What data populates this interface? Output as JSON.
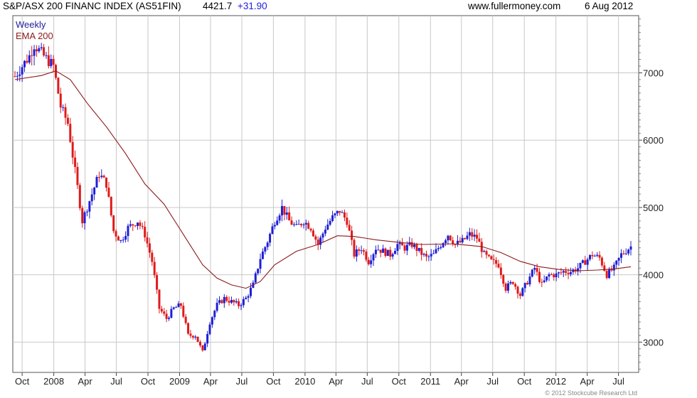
{
  "header": {
    "title": "S&P/ASX 200 FINANC INDEX (AS51FIN)",
    "last_value": "4421.7",
    "change": "+31.90",
    "site": "www.fullermoney.com",
    "date": "6 Aug 2012"
  },
  "copyright": "© 2012 Stockcube Research Ltd",
  "colors": {
    "up": "#1f1fd6",
    "down": "#e01a1a",
    "ema": "#8b1a1a",
    "grid": "#c8c8c8",
    "title_label": "#1f1f9c"
  },
  "chart_data": {
    "type": "candlestick",
    "title": "S&P/ASX 200 FINANC INDEX (AS51FIN)",
    "interval": "Weekly",
    "legend": [
      "Weekly",
      "EMA 200"
    ],
    "legend_position": "top-left",
    "x_range": [
      "2007-09-10",
      "2012-08-06"
    ],
    "ylim": [
      2550,
      7850
    ],
    "y_ticks": [
      3000,
      4000,
      5000,
      6000,
      7000
    ],
    "y_axis_position": "right",
    "grid": true,
    "x_ticks": [
      {
        "date": "2007-10-01",
        "label": "Oct"
      },
      {
        "date": "2008-01-01",
        "label": "2008"
      },
      {
        "date": "2008-04-01",
        "label": "Apr"
      },
      {
        "date": "2008-07-01",
        "label": "Jul"
      },
      {
        "date": "2008-10-01",
        "label": "Oct"
      },
      {
        "date": "2009-01-01",
        "label": "2009"
      },
      {
        "date": "2009-04-01",
        "label": "Apr"
      },
      {
        "date": "2009-07-01",
        "label": "Jul"
      },
      {
        "date": "2009-10-01",
        "label": "Oct"
      },
      {
        "date": "2010-01-01",
        "label": "2010"
      },
      {
        "date": "2010-04-01",
        "label": "Apr"
      },
      {
        "date": "2010-07-01",
        "label": "Jul"
      },
      {
        "date": "2010-10-01",
        "label": "Oct"
      },
      {
        "date": "2011-01-01",
        "label": "2011"
      },
      {
        "date": "2011-04-01",
        "label": "Apr"
      },
      {
        "date": "2011-07-01",
        "label": "Jul"
      },
      {
        "date": "2011-10-01",
        "label": "Oct"
      },
      {
        "date": "2012-01-01",
        "label": "2012"
      },
      {
        "date": "2012-04-01",
        "label": "Apr"
      },
      {
        "date": "2012-07-01",
        "label": "Jul"
      }
    ],
    "price_path": [
      [
        "2007-09-10",
        6950
      ],
      [
        "2007-10-22",
        7250
      ],
      [
        "2007-11-05",
        7420
      ],
      [
        "2007-12-03",
        7250
      ],
      [
        "2007-12-31",
        7100
      ],
      [
        "2008-01-21",
        6500
      ],
      [
        "2008-02-11",
        6250
      ],
      [
        "2008-03-10",
        5300
      ],
      [
        "2008-03-24",
        4800
      ],
      [
        "2008-04-21",
        5200
      ],
      [
        "2008-05-12",
        5500
      ],
      [
        "2008-06-02",
        5350
      ],
      [
        "2008-06-23",
        4650
      ],
      [
        "2008-07-14",
        4500
      ],
      [
        "2008-08-04",
        4700
      ],
      [
        "2008-09-01",
        4800
      ],
      [
        "2008-09-22",
        4600
      ],
      [
        "2008-10-13",
        4200
      ],
      [
        "2008-11-03",
        3500
      ],
      [
        "2008-11-24",
        3350
      ],
      [
        "2008-12-15",
        3500
      ],
      [
        "2009-01-05",
        3550
      ],
      [
        "2009-01-26",
        3100
      ],
      [
        "2009-02-16",
        3100
      ],
      [
        "2009-03-09",
        2850
      ],
      [
        "2009-03-30",
        3300
      ],
      [
        "2009-04-20",
        3550
      ],
      [
        "2009-05-11",
        3650
      ],
      [
        "2009-06-01",
        3600
      ],
      [
        "2009-06-22",
        3550
      ],
      [
        "2009-07-13",
        3650
      ],
      [
        "2009-08-03",
        3850
      ],
      [
        "2009-08-24",
        4250
      ],
      [
        "2009-09-14",
        4500
      ],
      [
        "2009-10-05",
        4800
      ],
      [
        "2009-10-26",
        5000
      ],
      [
        "2009-11-16",
        4800
      ],
      [
        "2009-12-07",
        4700
      ],
      [
        "2009-12-28",
        4800
      ],
      [
        "2010-01-18",
        4700
      ],
      [
        "2010-02-08",
        4450
      ],
      [
        "2010-03-01",
        4700
      ],
      [
        "2010-03-22",
        4850
      ],
      [
        "2010-04-12",
        4950
      ],
      [
        "2010-05-03",
        4800
      ],
      [
        "2010-05-24",
        4300
      ],
      [
        "2010-06-14",
        4400
      ],
      [
        "2010-07-05",
        4200
      ],
      [
        "2010-07-26",
        4400
      ],
      [
        "2010-08-16",
        4350
      ],
      [
        "2010-09-06",
        4300
      ],
      [
        "2010-09-27",
        4450
      ],
      [
        "2010-10-18",
        4400
      ],
      [
        "2010-11-08",
        4450
      ],
      [
        "2010-11-29",
        4350
      ],
      [
        "2010-12-20",
        4250
      ],
      [
        "2011-01-10",
        4300
      ],
      [
        "2011-01-31",
        4450
      ],
      [
        "2011-02-21",
        4600
      ],
      [
        "2011-03-14",
        4450
      ],
      [
        "2011-04-04",
        4500
      ],
      [
        "2011-04-25",
        4600
      ],
      [
        "2011-05-16",
        4550
      ],
      [
        "2011-06-06",
        4300
      ],
      [
        "2011-06-27",
        4200
      ],
      [
        "2011-07-18",
        4150
      ],
      [
        "2011-08-08",
        3800
      ],
      [
        "2011-08-29",
        3900
      ],
      [
        "2011-09-19",
        3700
      ],
      [
        "2011-10-10",
        3900
      ],
      [
        "2011-10-31",
        4100
      ],
      [
        "2011-11-21",
        3850
      ],
      [
        "2011-12-12",
        4000
      ],
      [
        "2012-01-02",
        4000
      ],
      [
        "2012-01-23",
        4050
      ],
      [
        "2012-02-13",
        4050
      ],
      [
        "2012-03-05",
        4100
      ],
      [
        "2012-03-26",
        4200
      ],
      [
        "2012-04-16",
        4300
      ],
      [
        "2012-05-07",
        4250
      ],
      [
        "2012-05-28",
        4000
      ],
      [
        "2012-06-18",
        4100
      ],
      [
        "2012-07-09",
        4300
      ],
      [
        "2012-08-06",
        4420
      ]
    ],
    "ema_path": [
      [
        "2007-09-10",
        6900
      ],
      [
        "2007-11-26",
        6960
      ],
      [
        "2008-01-07",
        7030
      ],
      [
        "2008-02-18",
        6900
      ],
      [
        "2008-04-07",
        6550
      ],
      [
        "2008-06-02",
        6200
      ],
      [
        "2008-07-28",
        5800
      ],
      [
        "2008-09-22",
        5350
      ],
      [
        "2008-11-17",
        5050
      ],
      [
        "2009-01-12",
        4600
      ],
      [
        "2009-03-09",
        4150
      ],
      [
        "2009-04-20",
        3950
      ],
      [
        "2009-06-01",
        3850
      ],
      [
        "2009-07-13",
        3800
      ],
      [
        "2009-08-24",
        3900
      ],
      [
        "2009-10-05",
        4150
      ],
      [
        "2009-12-07",
        4350
      ],
      [
        "2010-02-08",
        4450
      ],
      [
        "2010-04-05",
        4580
      ],
      [
        "2010-05-24",
        4570
      ],
      [
        "2010-07-26",
        4520
      ],
      [
        "2010-10-04",
        4480
      ],
      [
        "2010-12-06",
        4450
      ],
      [
        "2011-03-07",
        4460
      ],
      [
        "2011-05-30",
        4420
      ],
      [
        "2011-07-25",
        4330
      ],
      [
        "2011-09-19",
        4200
      ],
      [
        "2011-11-14",
        4120
      ],
      [
        "2012-01-09",
        4080
      ],
      [
        "2012-03-05",
        4060
      ],
      [
        "2012-04-30",
        4070
      ],
      [
        "2012-06-25",
        4090
      ],
      [
        "2012-08-06",
        4120
      ]
    ]
  }
}
